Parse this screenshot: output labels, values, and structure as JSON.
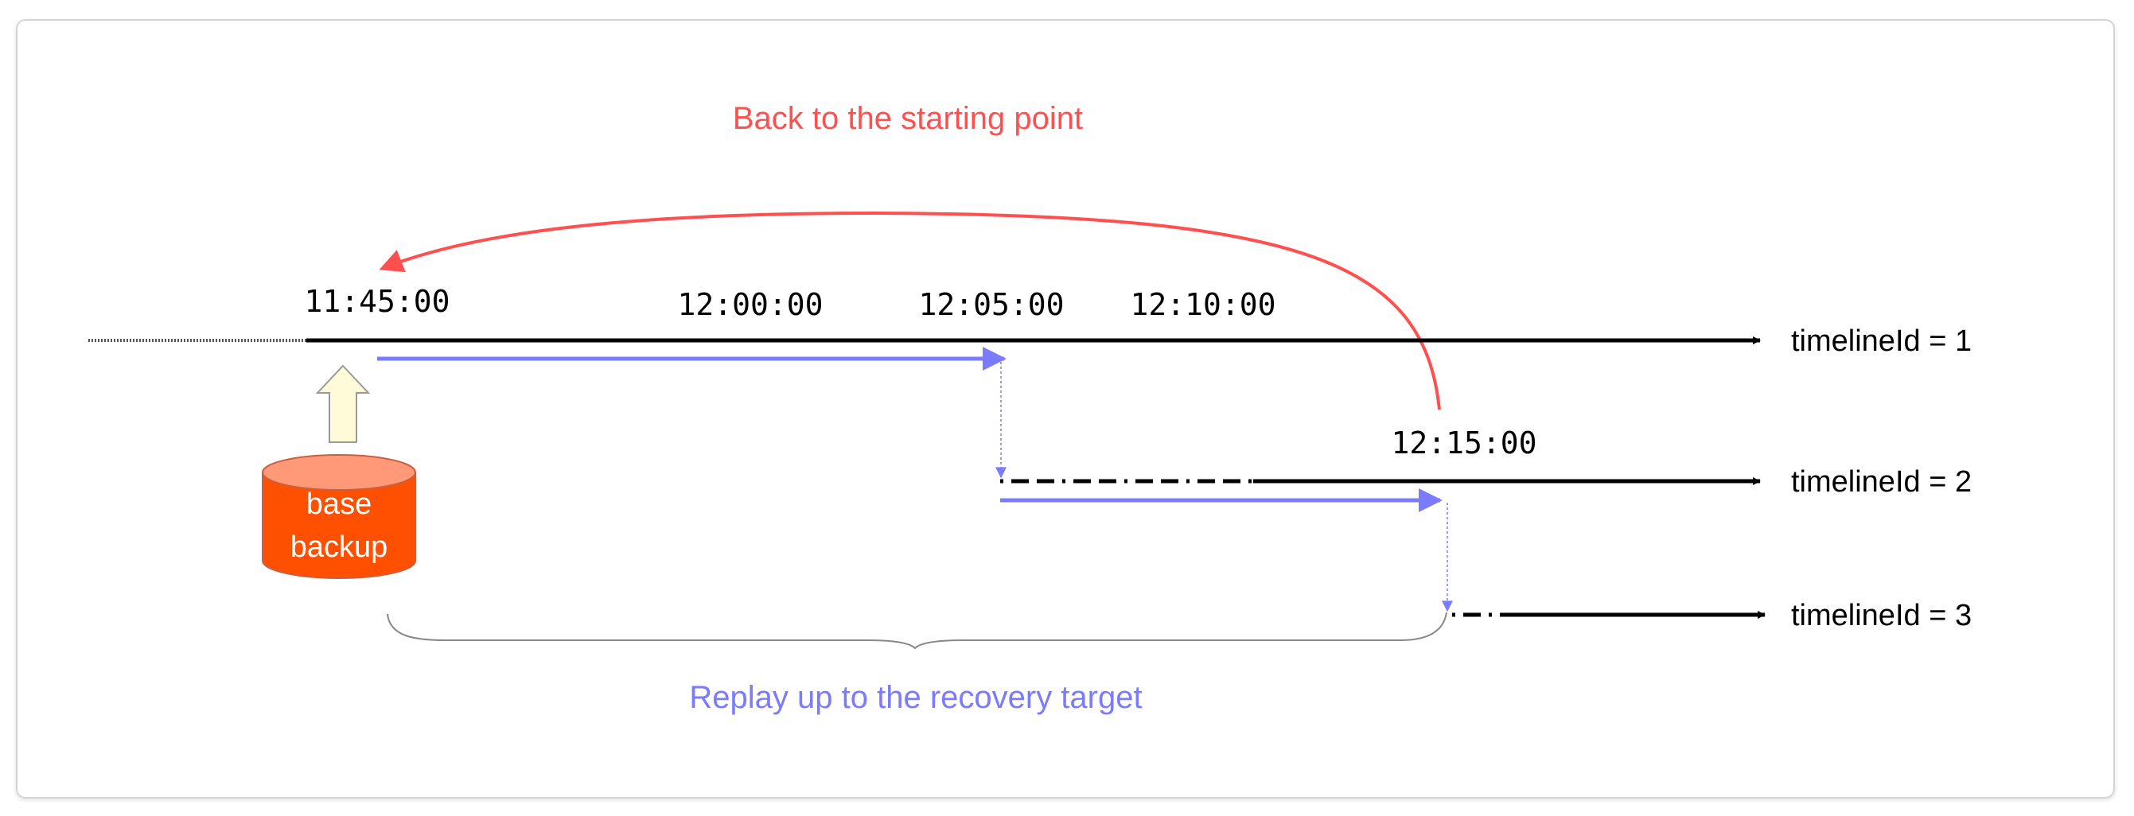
{
  "annotations": {
    "back_label": "Back to the starting point",
    "replay_label": "Replay up to the recovery target"
  },
  "times": {
    "t1145": "11:45:00",
    "t1200": "12:00:00",
    "t1205": "12:05:00",
    "t1210": "12:10:00",
    "t1215": "12:15:00"
  },
  "timelines": [
    {
      "label": "timelineId = 1"
    },
    {
      "label": "timelineId = 2"
    },
    {
      "label": "timelineId = 3"
    }
  ],
  "backup": {
    "line1": "base",
    "line2": "backup"
  },
  "colors": {
    "back_arrow": "#ff4f4f",
    "replay": "#7b7bff",
    "backup_body": "#ff4f00",
    "backup_top": "#ff9977",
    "base_arrow": "#fffbd8",
    "timeline": "#000000"
  }
}
